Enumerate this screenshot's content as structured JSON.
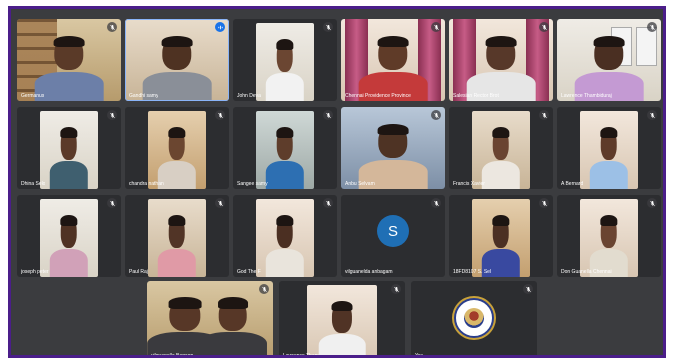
{
  "meeting": {
    "accent": "#4b1e8a",
    "tiles": [
      {
        "name": "Germanus",
        "mic": "mic-off-icon",
        "bg": "bg-a",
        "skin": "#5a3a28",
        "shirt": "#6c7fa8",
        "full": true,
        "shelf": true
      },
      {
        "name": "Gandhi samy",
        "mic": "speaking-icon",
        "bg": "bg-b",
        "skin": "#4e3222",
        "shirt": "#8a8f98",
        "speaking": true,
        "full": true
      },
      {
        "name": "John Deva",
        "mic": "mic-off-icon",
        "bg": "bg-c",
        "skin": "#6b4632",
        "shirt": "#f2f2f2"
      },
      {
        "name": "Chennai Providence Province",
        "mic": "mic-off-icon",
        "bg": "bg-f",
        "skin": "#5f3b28",
        "shirt": "#c43a3a",
        "full": true,
        "curtain": true
      },
      {
        "name": "Salesian Rector Brot",
        "mic": "mic-off-icon",
        "bg": "bg-f",
        "skin": "#573829",
        "shirt": "#e6e6e6",
        "full": true,
        "curtain": true
      },
      {
        "name": "Lawrence Thambiduraj",
        "mic": "mic-off-icon",
        "bg": "bg-c",
        "skin": "#4a2f22",
        "shirt": "#c49ad3",
        "full": true,
        "cal": true
      },
      {
        "name": "Dhina Selo",
        "mic": "mic-off-icon",
        "bg": "bg-c",
        "skin": "#5b3a29",
        "shirt": "#3f5f6f"
      },
      {
        "name": "chandra nathan",
        "mic": "mic-off-icon",
        "bg": "bg-e",
        "skin": "#6b4630",
        "shirt": "#d8cfc4"
      },
      {
        "name": "Sangee samy",
        "mic": "mic-off-icon",
        "bg": "bg-d",
        "skin": "#5e3d2b",
        "shirt": "#2d6fb2"
      },
      {
        "name": "Anbu Selvam",
        "mic": "speaking-icon",
        "bg": "bg-g",
        "skin": "#4e3324",
        "shirt": "#d4b79a",
        "full": true
      },
      {
        "name": "Francis Xavier",
        "mic": "mic-off-icon",
        "bg": "bg-b",
        "skin": "#6a4431",
        "shirt": "#ece7e0"
      },
      {
        "name": "A Bernard",
        "mic": "mic-off-icon",
        "bg": "bg-f",
        "skin": "#5e3b2a",
        "shirt": "#9cc0e6"
      },
      {
        "name": "joseph peter",
        "mic": "mic-off-icon",
        "bg": "bg-c",
        "skin": "#4f3223",
        "shirt": "#d1a1b8"
      },
      {
        "name": "Paul Raj",
        "mic": "mic-off-icon",
        "bg": "bg-b",
        "skin": "#513426",
        "shirt": "#e09aa6"
      },
      {
        "name": "God The F",
        "mic": "mic-off-icon",
        "bg": "bg-f",
        "skin": "#4b2f22",
        "shirt": "#e9e4dc"
      },
      {
        "name": "vilguanelda anbagam",
        "mic": "mic-off-icon",
        "avatar": "S"
      },
      {
        "name": "18FD8107 S. Sel",
        "mic": "mic-off-icon",
        "bg": "bg-e",
        "skin": "#4c3023",
        "shirt": "#3949a0"
      },
      {
        "name": "Don Guanella Chennai",
        "mic": "mic-off-icon",
        "bg": "bg-f",
        "skin": "#6a4431",
        "shirt": "#e2dccf"
      },
      {
        "name": "vilguanella Bagaon",
        "mic": "mic-off-icon",
        "bg": "bg-a",
        "skin": "#573727",
        "shirt": "#3a3a3e",
        "full": true,
        "two": true
      },
      {
        "name": "Lawrence Tham",
        "mic": "mic-off-icon",
        "bg": "bg-f",
        "skin": "#503325",
        "shirt": "#f0f0f0"
      },
      {
        "name": "You",
        "mic": "mic-off-icon",
        "logo": true
      }
    ]
  }
}
